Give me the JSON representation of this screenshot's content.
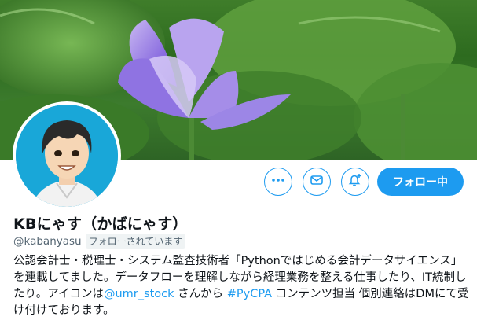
{
  "profile": {
    "display_name": "KBにゃす（かばにゃす）",
    "handle": "@kabanyasu",
    "follows_you": "フォローされています",
    "bio": {
      "t1": "公認会計士・税理士・システム監査技術者「Pythonではじめる会計データサイエンス」を連載してました。データフローを理解しながら経理業務を整える仕事したり、IT統制したり。アイコンは",
      "mention": "@umr_stock",
      "t2": " さんから ",
      "hashtag": "#PyCPA",
      "t3": " コンテンツ担当 個別連絡はDMにて受け付けております。"
    }
  },
  "actions": {
    "more_icon": "more-dots-icon",
    "message_icon": "envelope-icon",
    "notify_icon": "bell-plus-icon",
    "follow_label": "フォロー中"
  },
  "colors": {
    "accent": "#1d9bf0",
    "avatar_bg": "#19a7d8"
  }
}
